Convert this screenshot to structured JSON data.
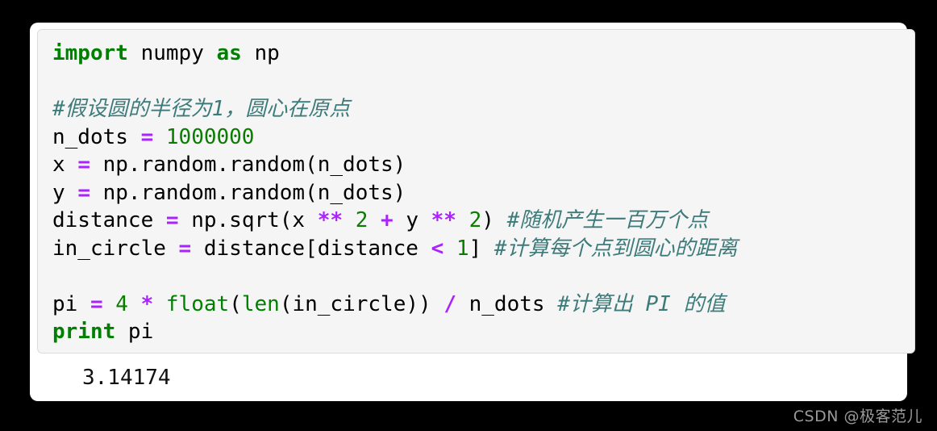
{
  "page": {
    "background_color": "#000000",
    "card_background_color": "#ffffff"
  },
  "code_block": {
    "background_color": "#f5f5f5",
    "border_color": "#dcdcdc",
    "language": "python",
    "colors": {
      "keyword": "#008000",
      "builtin": "#008000",
      "number": "#0a7d00",
      "operator": "#aa22ff",
      "comment": "#3d7b7b",
      "text": "#000000"
    },
    "lines": [
      {
        "index": 1,
        "text": "import numpy as np",
        "tokens": [
          {
            "t": "import",
            "c": "kw"
          },
          {
            "t": " numpy ",
            "c": "plain"
          },
          {
            "t": "as",
            "c": "kw"
          },
          {
            "t": " np",
            "c": "plain"
          }
        ]
      },
      {
        "index": 2,
        "text": "",
        "tokens": []
      },
      {
        "index": 3,
        "text": "#假设圆的半径为1，圆心在原点",
        "tokens": [
          {
            "t": "#假设圆的半径为1，圆心在原点",
            "c": "cmt"
          }
        ]
      },
      {
        "index": 4,
        "text": "n_dots = 1000000",
        "tokens": [
          {
            "t": "n_dots ",
            "c": "plain"
          },
          {
            "t": "=",
            "c": "op"
          },
          {
            "t": " ",
            "c": "plain"
          },
          {
            "t": "1000000",
            "c": "num"
          }
        ]
      },
      {
        "index": 5,
        "text": "x = np.random.random(n_dots)",
        "tokens": [
          {
            "t": "x ",
            "c": "plain"
          },
          {
            "t": "=",
            "c": "op"
          },
          {
            "t": " np.random.random(n_dots)",
            "c": "plain"
          }
        ]
      },
      {
        "index": 6,
        "text": "y = np.random.random(n_dots)",
        "tokens": [
          {
            "t": "y ",
            "c": "plain"
          },
          {
            "t": "=",
            "c": "op"
          },
          {
            "t": " np.random.random(n_dots)",
            "c": "plain"
          }
        ]
      },
      {
        "index": 7,
        "text": "distance = np.sqrt(x ** 2 + y ** 2) #随机产生一百万个点",
        "tokens": [
          {
            "t": "distance ",
            "c": "plain"
          },
          {
            "t": "=",
            "c": "op"
          },
          {
            "t": " np.sqrt(x ",
            "c": "plain"
          },
          {
            "t": "**",
            "c": "op"
          },
          {
            "t": " ",
            "c": "plain"
          },
          {
            "t": "2",
            "c": "num"
          },
          {
            "t": " ",
            "c": "plain"
          },
          {
            "t": "+",
            "c": "op"
          },
          {
            "t": " y ",
            "c": "plain"
          },
          {
            "t": "**",
            "c": "op"
          },
          {
            "t": " ",
            "c": "plain"
          },
          {
            "t": "2",
            "c": "num"
          },
          {
            "t": ") ",
            "c": "plain"
          },
          {
            "t": "#随机产生一百万个点",
            "c": "cmt"
          }
        ]
      },
      {
        "index": 8,
        "text": "in_circle = distance[distance < 1] #计算每个点到圆心的距离",
        "tokens": [
          {
            "t": "in_circle ",
            "c": "plain"
          },
          {
            "t": "=",
            "c": "op"
          },
          {
            "t": " distance[distance ",
            "c": "plain"
          },
          {
            "t": "<",
            "c": "op"
          },
          {
            "t": " ",
            "c": "plain"
          },
          {
            "t": "1",
            "c": "num"
          },
          {
            "t": "] ",
            "c": "plain"
          },
          {
            "t": "#计算每个点到圆心的距离",
            "c": "cmt"
          }
        ]
      },
      {
        "index": 9,
        "text": "",
        "tokens": []
      },
      {
        "index": 10,
        "text": "pi = 4 * float(len(in_circle)) / n_dots #计算出 PI 的值",
        "tokens": [
          {
            "t": "pi ",
            "c": "plain"
          },
          {
            "t": "=",
            "c": "op"
          },
          {
            "t": " ",
            "c": "plain"
          },
          {
            "t": "4",
            "c": "num"
          },
          {
            "t": " ",
            "c": "plain"
          },
          {
            "t": "*",
            "c": "op"
          },
          {
            "t": " ",
            "c": "plain"
          },
          {
            "t": "float",
            "c": "builtin"
          },
          {
            "t": "(",
            "c": "plain"
          },
          {
            "t": "len",
            "c": "builtin"
          },
          {
            "t": "(in_circle)) ",
            "c": "plain"
          },
          {
            "t": "/",
            "c": "op"
          },
          {
            "t": " n_dots ",
            "c": "plain"
          },
          {
            "t": "#计算出 PI 的值",
            "c": "cmt"
          }
        ]
      },
      {
        "index": 11,
        "text": "print pi",
        "tokens": [
          {
            "t": "print",
            "c": "kw"
          },
          {
            "t": " pi",
            "c": "plain"
          }
        ]
      }
    ]
  },
  "output": {
    "value": "3.14174"
  },
  "watermark": {
    "text": "CSDN @极客范儿",
    "color": "#9a9a9a"
  }
}
